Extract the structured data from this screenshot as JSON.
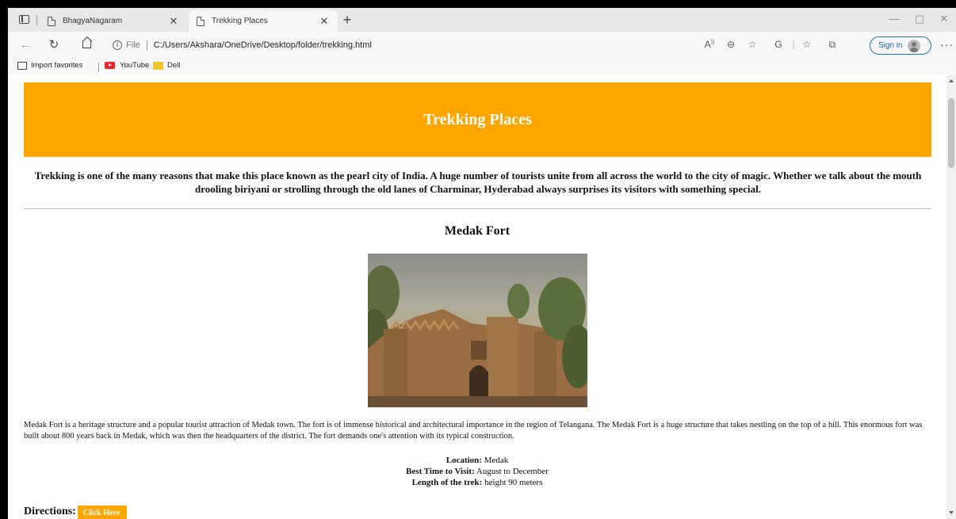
{
  "browser": {
    "tabs": [
      {
        "label": "BhagyaNagaram",
        "active": false
      },
      {
        "label": "Trekking Places",
        "active": true
      }
    ],
    "address": {
      "scheme_label": "File",
      "url": "C:/Users/Akshara/OneDrive/Desktop/folder/trekking.html"
    },
    "signin_label": "Sign in",
    "favorites": [
      {
        "label": "Import favorites",
        "icon": "import-icon"
      },
      {
        "label": "YouTube",
        "icon": "youtube-icon"
      },
      {
        "label": "Dell",
        "icon": "folder-icon"
      }
    ]
  },
  "page": {
    "banner_title": "Trekking Places",
    "intro": "Trekking is one of the many reasons that make this place known as the pearl city of India. A huge number of tourists unite from all across the world to the city of magic. Whether we talk about the mouth drooling biriyani or strolling through the old lanes of Charminar, Hyderabad always surprises its visitors with something special.",
    "place": {
      "title": "Medak Fort",
      "description": "Medak Fort is a heritage structure and a popular tourist attraction of Medak town. The fort is of immense historical and architectural importance in the region of Telangana. The Medak Fort is a huge structure that takes nestling on the top of a hill. This enormous fort was built about 800 years back in Medak, which was then the headquarters of the district. The fort demands one's attention with its typical construction.",
      "location_label": "Location:",
      "location": "Medak",
      "best_time_label": "Best Time to Visit:",
      "best_time": "August to December",
      "length_label": "Length of the trek:",
      "length": "height 90 meters"
    },
    "directions_label": "Directions:",
    "directions_button": "Click Here"
  },
  "colors": {
    "accent": "#ffa500",
    "link_blue": "#1a73c8"
  }
}
